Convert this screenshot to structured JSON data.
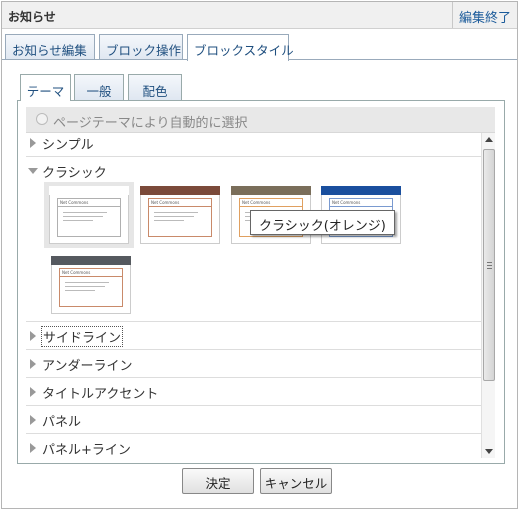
{
  "window": {
    "title": "お知らせ",
    "end_edit": "編集終了"
  },
  "tabs": [
    {
      "label": "お知らせ編集",
      "active": false
    },
    {
      "label": "ブロック操作",
      "active": false
    },
    {
      "label": "ブロックスタイル",
      "active": true
    }
  ],
  "subtabs": [
    {
      "label": "テーマ",
      "active": true
    },
    {
      "label": "一般",
      "active": false
    },
    {
      "label": "配色",
      "active": false
    }
  ],
  "auto_select": {
    "label": "ページテーマにより自動的に選択",
    "selected": false
  },
  "theme_groups": [
    {
      "label": "シンプル",
      "expanded": false
    },
    {
      "label": "クラシック",
      "expanded": true
    },
    {
      "label": "サイドライン",
      "expanded": false,
      "focused": true
    },
    {
      "label": "アンダーライン",
      "expanded": false
    },
    {
      "label": "タイトルアクセント",
      "expanded": false
    },
    {
      "label": "パネル",
      "expanded": false
    },
    {
      "label": "パネル+ライン",
      "expanded": false
    }
  ],
  "classic_thumbnails": [
    {
      "header_color": "#ffffff",
      "accent_color": "#b0b0b0",
      "selected": true,
      "title": "Net Commons"
    },
    {
      "header_color": "#7b4a3a",
      "accent_color": "#c98a6a",
      "selected": false,
      "title": "Net Commons"
    },
    {
      "header_color": "#7a6e5a",
      "accent_color": "#e0a060",
      "selected": false,
      "title": "Net Commons"
    },
    {
      "header_color": "#1a4f9e",
      "accent_color": "#7a9ad0",
      "selected": false,
      "title": "Net Commons"
    },
    {
      "header_color": "#55595f",
      "accent_color": "#c98a6a",
      "selected": false,
      "title": "Net Commons"
    }
  ],
  "tooltip": "クラシック(オレンジ)",
  "buttons": {
    "ok": "決定",
    "cancel": "キャンセル"
  }
}
